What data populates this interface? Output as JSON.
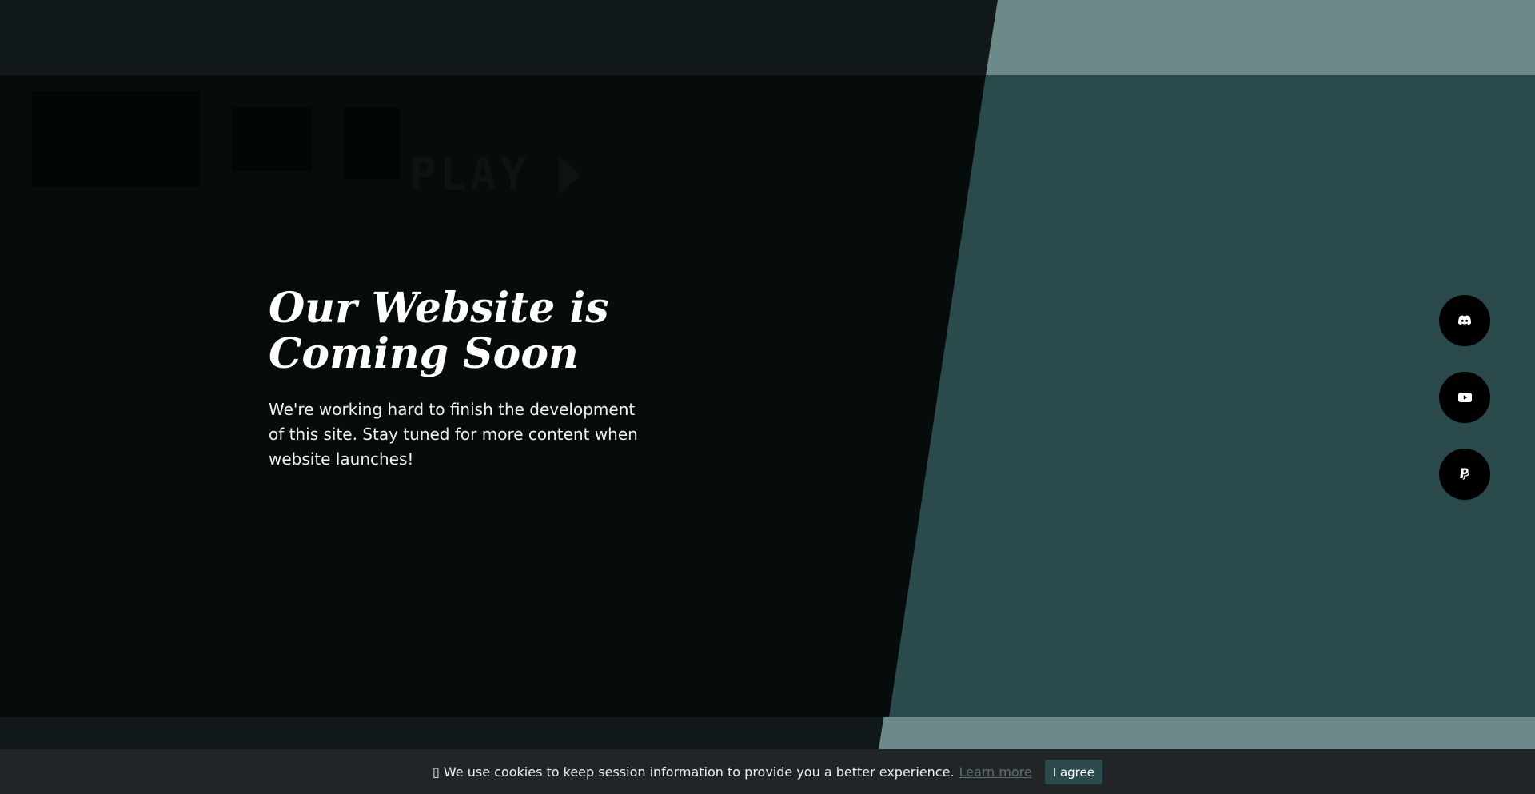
{
  "hero": {
    "title_line1": "Our Website is",
    "title_line2": "Coming Soon",
    "description": "We're working hard to finish the development of this site. Stay tuned for more content when website launches!"
  },
  "background": {
    "ghost_text": "PLAY",
    "colors": {
      "dark": "#060b0b",
      "band": "#111819",
      "teal_dark": "#2a4a4c",
      "teal_light": "#6b8a89"
    }
  },
  "social": [
    {
      "name": "discord",
      "icon": "discord-icon"
    },
    {
      "name": "youtube",
      "icon": "youtube-icon"
    },
    {
      "name": "paypal",
      "icon": "paypal-icon"
    }
  ],
  "cookie_banner": {
    "icon": "cookie-icon",
    "text": "We use cookies to keep session information to provide you a better experience.",
    "link_text": "Learn more",
    "button_label": "I agree",
    "accent": "#2a4a4c"
  }
}
